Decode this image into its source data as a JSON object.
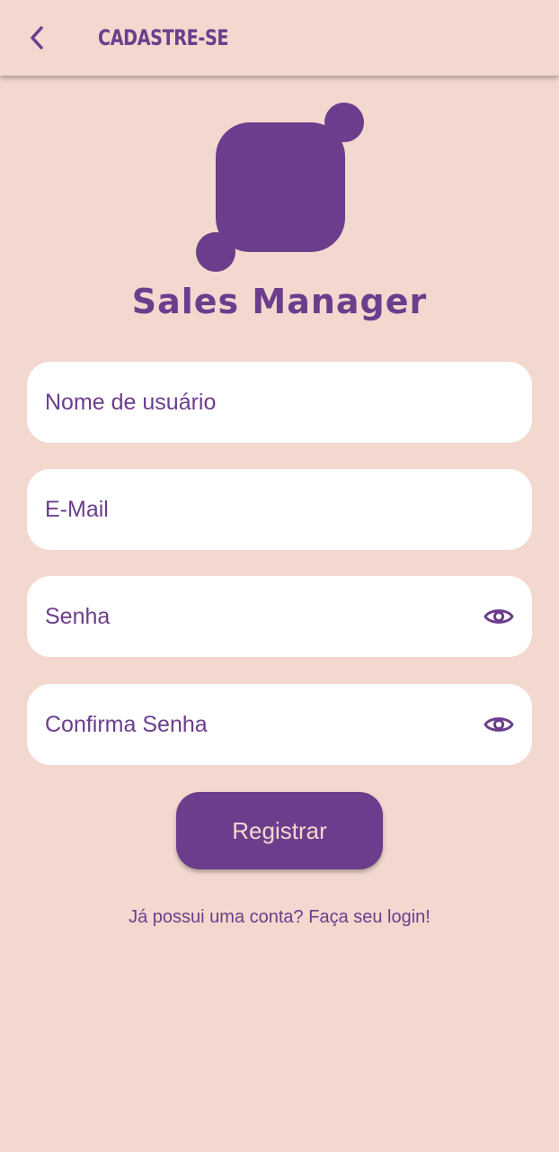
{
  "header": {
    "title": "CADASTRE-SE",
    "back_icon": "chevron-left-icon"
  },
  "brand": {
    "app_name": "Sales Manager",
    "logo_icon": "sales-manager-logo"
  },
  "form": {
    "username": {
      "placeholder": "Nome de usuário",
      "value": ""
    },
    "email": {
      "placeholder": "E-Mail",
      "value": ""
    },
    "password": {
      "placeholder": "Senha",
      "value": "",
      "toggle_icon": "eye-icon"
    },
    "confirm_password": {
      "placeholder": "Confirma Senha",
      "value": "",
      "toggle_icon": "eye-icon"
    },
    "register_label": "Registrar",
    "login_link": "Já possui uma conta? Faça seu login!"
  },
  "colors": {
    "background": "#f2d8cf",
    "accent": "#6c3d8c",
    "field_background": "#ffffff"
  }
}
